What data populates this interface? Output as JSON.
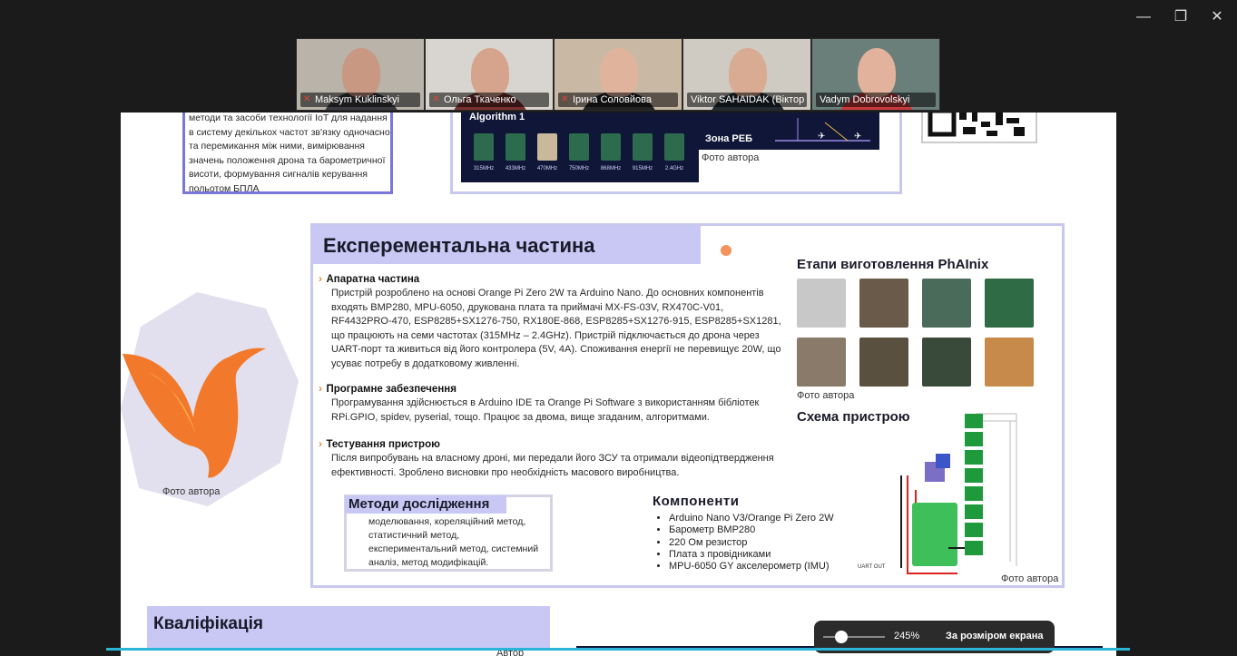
{
  "window": {
    "controls": {
      "minimize": "—",
      "restore": "❐",
      "close": "✕"
    }
  },
  "participants": [
    {
      "name": "Maksym Kuklinskyi",
      "muted": true,
      "active": false,
      "bg": "#b9b3aa",
      "shirt": "#3a3a40",
      "face": "#c99883"
    },
    {
      "name": "Ольга Ткаченко",
      "muted": true,
      "active": false,
      "bg": "#d8d4cf",
      "shirt": "#7a2f2f",
      "face": "#d6a48c"
    },
    {
      "name": "Ірина Соловйова",
      "muted": true,
      "active": false,
      "bg": "#c9b9a4",
      "shirt": "#222222",
      "face": "#e0b39d"
    },
    {
      "name": "Viktor SAHAIDAK (Віктор ...",
      "muted": false,
      "active": true,
      "bg": "#cfcac2",
      "shirt": "#1f2a33",
      "face": "#d9ab92"
    },
    {
      "name": "Vadym Dobrovolskyi",
      "muted": false,
      "active": false,
      "bg": "#6a7f7a",
      "shirt": "#c93a3a",
      "face": "#e2b29c"
    }
  ],
  "slide": {
    "top_left_text": "методи та засоби технології IoT для надання в систему декількох частот зв'язку одночасно та перемикання між ними, вимірювання значень положення дрона та барометричної висоти, формування сигналів керування польотом БПЛА",
    "algorithm_label": "Algorithm 1",
    "freq_labels": [
      "315MHz",
      "433MHz",
      "470MHz",
      "750MHz",
      "868MHz",
      "915MHz",
      "2.4GHz"
    ],
    "zone_label": "Зона РЕБ",
    "photo_credit": "Фото автора",
    "section_title": "Експерементальна частина",
    "blocks": [
      {
        "title": "Апаратна частина",
        "body": "Пристрій розроблено на основі Orange Pi Zero 2W та Arduino Nano. До основних компонентів входять BMP280, MPU-6050, друкована плата та приймачі MX-FS-03V, RX470C-V01, RF4432PRO-470, ESP8285+SX1276-750, RX180E-868, ESP8285+SX1276-915, ESP8285+SX1281, що працюють на семи частотах (315MHz – 2.4GHz). Пристрій підключається до дрона через UART-порт та живиться від його контролера (5V, 4A). Споживання енергії не перевищує 20W, що усуває потребу в додатковому живленні."
      },
      {
        "title": "Програмне забезпечення",
        "body": "Програмування здійснюється в Arduino IDE та Orange Pi Software з використанням бібліотек RPi.GPIO, spidev, pyserial, тощо. Працює за двома, вище згаданим, алгоритмами."
      },
      {
        "title": "Тестування пристрою",
        "body": "Після випробувань на власному дроні, ми передали його ЗСУ та отримали відеопідтвердження ефективності. Зроблено висновки про необхідність масового виробництва."
      }
    ],
    "methods_title": "Методи дослідження",
    "methods_body": "моделювання, кореляційний метод, статистичний метод, експериментальний метод, системний аналіз, метод модифікацій.",
    "components_title": "Компоненти",
    "components": [
      "Arduino Nano V3/Orange Pi Zero 2W",
      "Барометр BMP280",
      "220 Ом резистор",
      "Плата з провідниками",
      "MPU-6050 GY акселерометр (IMU)"
    ],
    "stages_title": "Етапи виготовлення PhAInix",
    "scheme_title": "Схема пристрою",
    "uart_label": "UART OUT",
    "qualification_title": "Кваліфікація",
    "bottom_cut_text": "Автор"
  },
  "zoom": {
    "value": "245%",
    "level": 0.3,
    "fit_label": "За розміром екрана"
  }
}
